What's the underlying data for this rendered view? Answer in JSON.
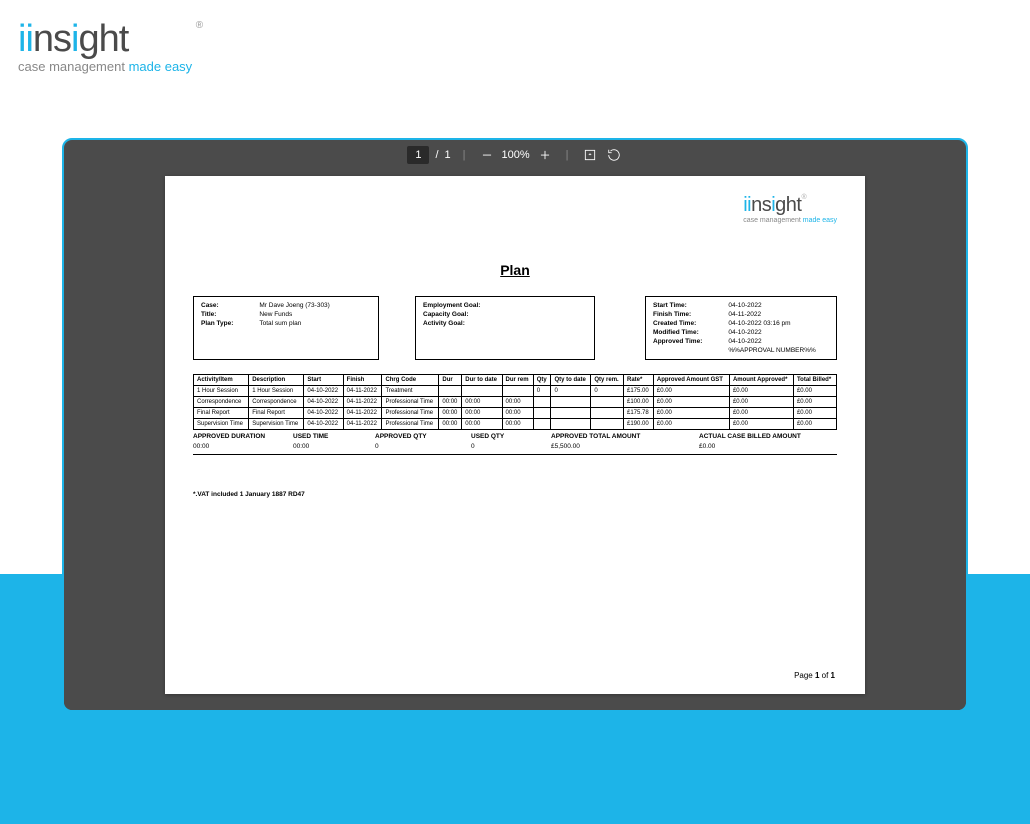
{
  "brand": {
    "name": "iinsight",
    "reg": "®",
    "tagline_a": "case management ",
    "tagline_b": "made easy"
  },
  "viewer": {
    "current_page": "1",
    "page_sep": "/",
    "total_pages": "1",
    "zoom": "100%"
  },
  "doc": {
    "title": "Plan",
    "meta1": {
      "case_lbl": "Case:",
      "case_val": "Mr Dave Joeng (73-303)",
      "title_lbl": "Title:",
      "title_val": "New Funds",
      "plantype_lbl": "Plan Type:",
      "plantype_val": "Total sum plan"
    },
    "meta2": {
      "emp_lbl": "Employment Goal:",
      "emp_val": "",
      "cap_lbl": "Capacity Goal:",
      "cap_val": "",
      "act_lbl": "Activity Goal:",
      "act_val": ""
    },
    "meta3": {
      "start_lbl": "Start Time:",
      "start_val": "04-10-2022",
      "finish_lbl": "Finish Time:",
      "finish_val": "04-11-2022",
      "created_lbl": "Created Time:",
      "created_val": "04-10-2022 03:16 pm",
      "modified_lbl": "Modified Time:",
      "modified_val": "04-10-2022",
      "approved_lbl": "Approved Time:",
      "approved_val": "04-10-2022",
      "approval_num": "%%APPROVAL NUMBER%%"
    },
    "headers": [
      "Activity/Item",
      "Description",
      "Start",
      "Finish",
      "Chrg Code",
      "Dur",
      "Dur to date",
      "Dur rem",
      "Qty",
      "Qty to date",
      "Qty rem.",
      "Rate*",
      "Approved Amount GST",
      "Amount Approved*",
      "Total Billed*"
    ],
    "rows": [
      [
        "1 Hour Session",
        "1 Hour Session",
        "04-10-2022",
        "04-11-2022",
        "Treatment",
        "",
        "",
        "",
        "0",
        "0",
        "0",
        "£175.00",
        "£0.00",
        "£0.00",
        "£0.00"
      ],
      [
        "Correspondence",
        "Correspondence",
        "04-10-2022",
        "04-11-2022",
        "Professional Time",
        "00:00",
        "00:00",
        "00:00",
        "",
        "",
        "",
        "£100.00",
        "£0.00",
        "£0.00",
        "£0.00"
      ],
      [
        "Final Report",
        "Final Report",
        "04-10-2022",
        "04-11-2022",
        "Professional Time",
        "00:00",
        "00:00",
        "00:00",
        "",
        "",
        "",
        "£175.78",
        "£0.00",
        "£0.00",
        "£0.00"
      ],
      [
        "Supervision Time",
        "Supervision Time",
        "04-10-2022",
        "04-11-2022",
        "Professional Time",
        "00:00",
        "00:00",
        "00:00",
        "",
        "",
        "",
        "£190.00",
        "£0.00",
        "£0.00",
        "£0.00"
      ]
    ],
    "totals": {
      "h1": "APPROVED DURATION",
      "v1": "00:00",
      "h2": "USED TIME",
      "v2": "00:00",
      "h3": "APPROVED QTY",
      "v3": "0",
      "h4": "USED QTY",
      "v4": "0",
      "h5": "APPROVED TOTAL AMOUNT",
      "v5": "£5,500.00",
      "h6": "ACTUAL CASE BILLED AMOUNT",
      "v6": "£0.00"
    },
    "footnote": "*.VAT included 1 January 1887 RD47",
    "pagenum_a": "Page ",
    "pagenum_b": "1",
    "pagenum_c": " of ",
    "pagenum_d": "1"
  }
}
